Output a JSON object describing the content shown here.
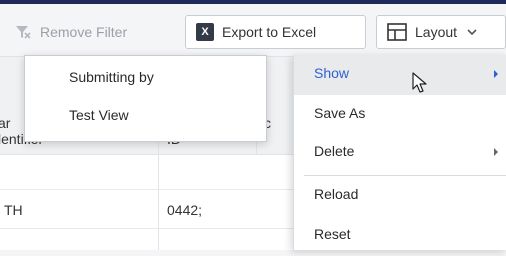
{
  "toolbar": {
    "remove_filter": "Remove Filter",
    "export_excel": "Export to Excel",
    "excel_letter": "X",
    "layout": "Layout"
  },
  "table": {
    "header": {
      "col1_line1": "ar",
      "col1_line2": "lentifier",
      "col2": "ID",
      "col3_partial": "c"
    },
    "rows": [
      {
        "col1": "",
        "col2": ""
      },
      {
        "col1": "TH",
        "col2": "0442;"
      },
      {
        "col1": "",
        "col2": ""
      }
    ]
  },
  "submenu": {
    "items": [
      "Submitting by",
      "Test View"
    ]
  },
  "menu": {
    "items": [
      {
        "label": "Show",
        "has_submenu": true,
        "active": true
      },
      {
        "label": "Save As",
        "has_submenu": false
      },
      {
        "label": "Delete",
        "has_submenu": true
      },
      {
        "label": "Reload",
        "has_submenu": false
      },
      {
        "label": "Reset",
        "has_submenu": false
      }
    ]
  },
  "colors": {
    "accent": "#2f5fd0",
    "topbar": "#1f2a5a",
    "excel_badge": "#333a48"
  }
}
